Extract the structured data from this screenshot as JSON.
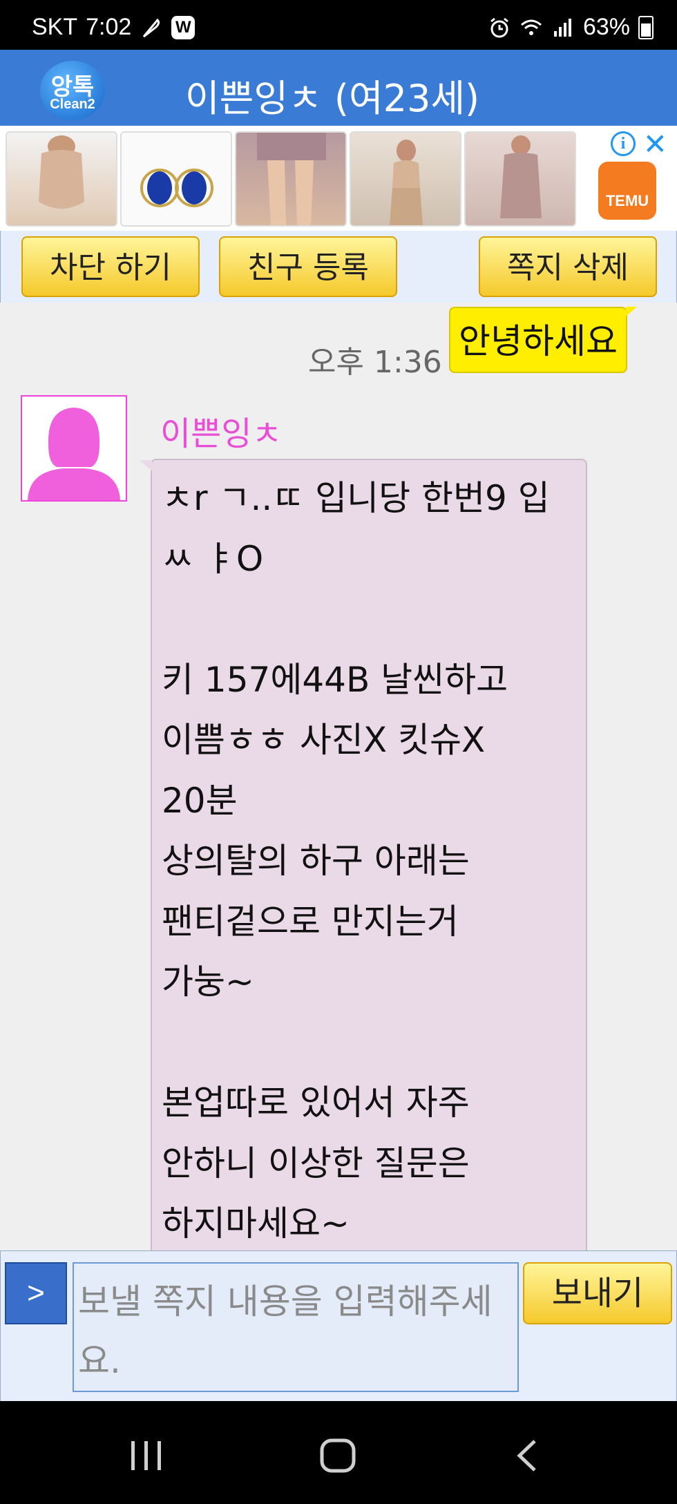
{
  "status_bar": {
    "carrier": "SKT",
    "time": "7:02",
    "notif_badge": "W",
    "battery": "63%",
    "battery_level": 0.63
  },
  "app_bar": {
    "logo_top": "앙톡",
    "logo_bottom": "Clean2",
    "title": "이쁜잉ㅊ (여23세)",
    "color": "#3a7bd5"
  },
  "ad": {
    "advertiser": "TEMU",
    "info_icon": "info-icon",
    "close_icon": "close-icon"
  },
  "actions": {
    "block_label": "차단 하기",
    "add_friend_label": "친구 등록",
    "delete_label": "쪽지 삭제"
  },
  "chat": {
    "my_message": "안녕하세요",
    "my_time": "오후 1:36",
    "sender_name": "이쁜잉ㅊ",
    "their_message": "ㅊr ㄱ..ㄸ 입니당 한번9 입\nㅆ ㅑO\n\n키 157에44B 날씬하고\n이쁨ㅎㅎ 사진X 킷슈X\n20분\n상의탈의 하구 아래는\n팬티겉으로 만지는거\n가눙~\n\n본업따로 있어서 자주\n안하니 이상한 질문은\n하지마세요~"
  },
  "composer": {
    "expand_label": ">",
    "placeholder": "보낼 쪽지 내용을 입력해주세요.",
    "send_label": "보내기"
  },
  "colors": {
    "my_bubble": "#ffee00",
    "their_bubble": "#ead9e6",
    "sender_name": "#e84fd6",
    "button_yellow": "#f5c92c"
  }
}
